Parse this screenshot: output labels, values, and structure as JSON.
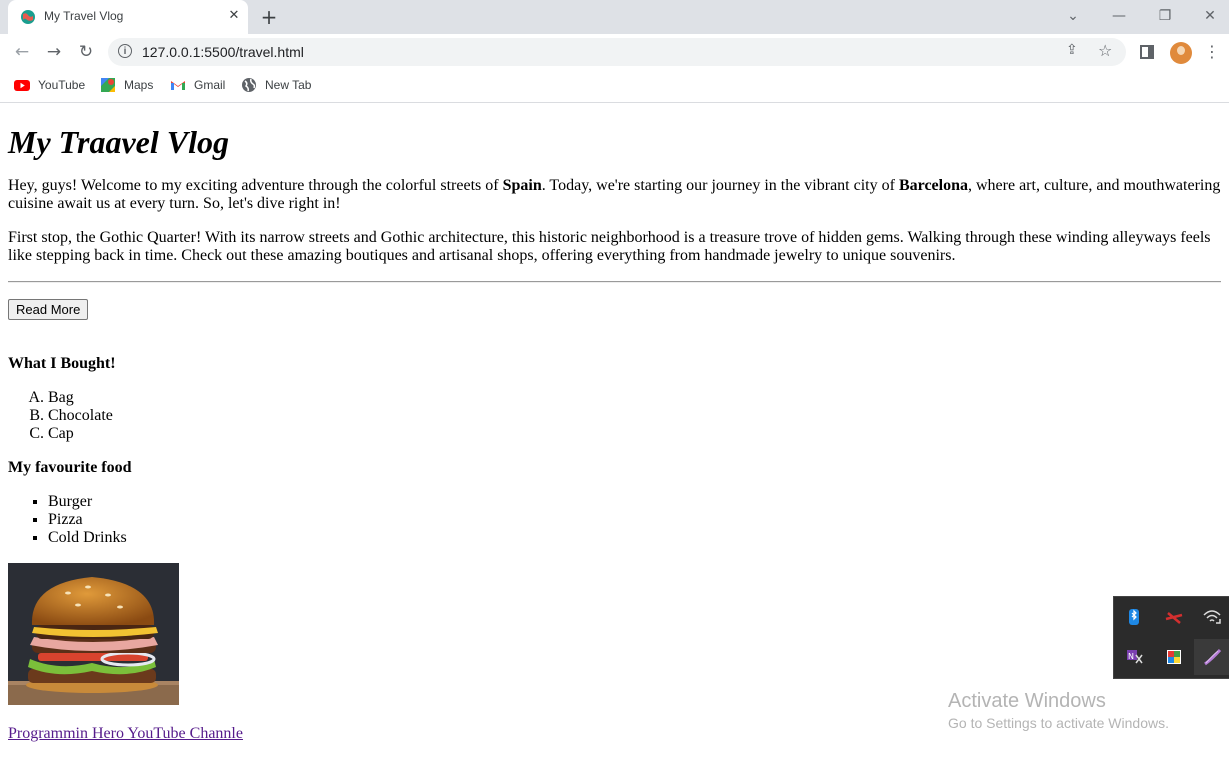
{
  "browser": {
    "tab_title": "My Travel Vlog",
    "tab_close": "✕",
    "new_tab": "+",
    "url": "127.0.0.1:5500/travel.html",
    "bookmarks": [
      {
        "label": "YouTube",
        "icon": "youtube-icon"
      },
      {
        "label": "Maps",
        "icon": "maps-icon"
      },
      {
        "label": "Gmail",
        "icon": "gmail-icon"
      },
      {
        "label": "New Tab",
        "icon": "globe-icon"
      }
    ],
    "controls": {
      "tab_search": "⌄",
      "minimize": "—",
      "restore": "❐",
      "close": "✕",
      "back": "←",
      "forward": "→",
      "reload": "↻",
      "menu": "⋮",
      "share": "⇪",
      "star": "☆"
    }
  },
  "page": {
    "heading": "My Traavel Vlog",
    "p1": {
      "a": "Hey, guys! Welcome to my exciting adventure through the colorful streets of ",
      "spain": "Spain",
      "b": ". Today, we're starting our journey in the vibrant city of ",
      "barcelona": "Barcelona",
      "c": ", where art, culture, and mouthwatering cuisine await us at every turn. So, let's dive right in!"
    },
    "p2": "First stop, the Gothic Quarter! With its narrow streets and Gothic architecture, this historic neighborhood is a treasure trove of hidden gems. Walking through these winding alleyways feels like stepping back in time. Check out these amazing boutiques and artisanal shops, offering everything from handmade jewelry to unique souvenirs.",
    "read_more": "Read More",
    "bought_heading": "What I Bought!",
    "bought": [
      "Bag",
      "Chocolate",
      "Cap"
    ],
    "food_heading": "My favourite food",
    "food": [
      "Burger",
      "Pizza",
      "Cold Drinks"
    ],
    "link": "Programmin Hero YouTube Channle"
  },
  "tray": {
    "icons": [
      "bluetooth-icon",
      "network-error-icon",
      "wifi-icon",
      "onenote-clip-icon",
      "color-picker-icon",
      "pen-icon"
    ]
  },
  "watermark": {
    "line1": "Activate Windows",
    "line2": "Go to Settings to activate Windows."
  },
  "colors": {
    "link_visited": "#551a8b",
    "chrome_bg": "#dee1e6",
    "omnibox_bg": "#f1f3f4"
  }
}
